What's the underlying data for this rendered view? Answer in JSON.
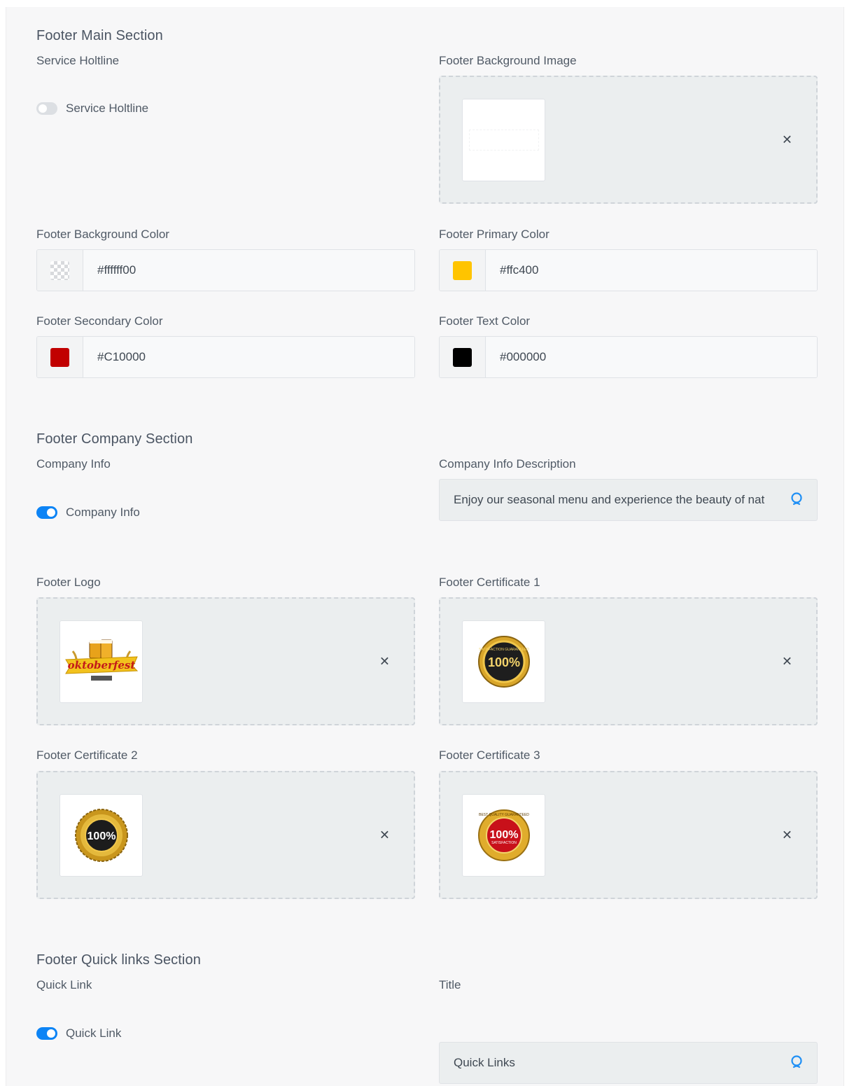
{
  "main_section": {
    "title": "Footer Main Section",
    "service_hotline_label": "Service Holtline",
    "service_hotline_toggle_label": "Service Holtline",
    "service_hotline_enabled": false,
    "bg_image_label": "Footer Background Image",
    "bg_color_label": "Footer Background Color",
    "bg_color_value": "#ffffff00",
    "primary_color_label": "Footer Primary Color",
    "primary_color_value": "#ffc400",
    "secondary_color_label": "Footer Secondary Color",
    "secondary_color_value": "#C10000",
    "text_color_label": "Footer Text Color",
    "text_color_value": "#000000"
  },
  "company_section": {
    "title": "Footer Company Section",
    "company_info_label": "Company Info",
    "company_info_toggle_label": "Company Info",
    "company_info_enabled": true,
    "description_label": "Company Info Description",
    "description_value": "Enjoy our seasonal menu and experience the beauty of nat",
    "logo_label": "Footer Logo",
    "logo_text": "oktoberfest",
    "cert1_label": "Footer Certificate 1",
    "cert2_label": "Footer Certificate 2",
    "cert3_label": "Footer Certificate 3",
    "cert_badge_text": "100%",
    "cert1_ring_text": "SATISFACTION GUARANTEED",
    "cert3_ring_text": "BEST QUALITY GUARANTEED",
    "cert3_inner_text": "SATISFACTION"
  },
  "quicklinks_section": {
    "title": "Footer Quick links Section",
    "quick_link_label": "Quick Link",
    "quick_link_toggle_label": "Quick Link",
    "quick_link_enabled": true,
    "title_label": "Title",
    "title_value": "Quick Links"
  },
  "icons": {
    "remove": "close-icon",
    "translate": "globe-icon",
    "transparent": "checkerboard-icon"
  },
  "colors": {
    "toggle_on": "#0d84f5",
    "primary": "#ffc400",
    "secondary": "#C10000",
    "text": "#000000"
  }
}
